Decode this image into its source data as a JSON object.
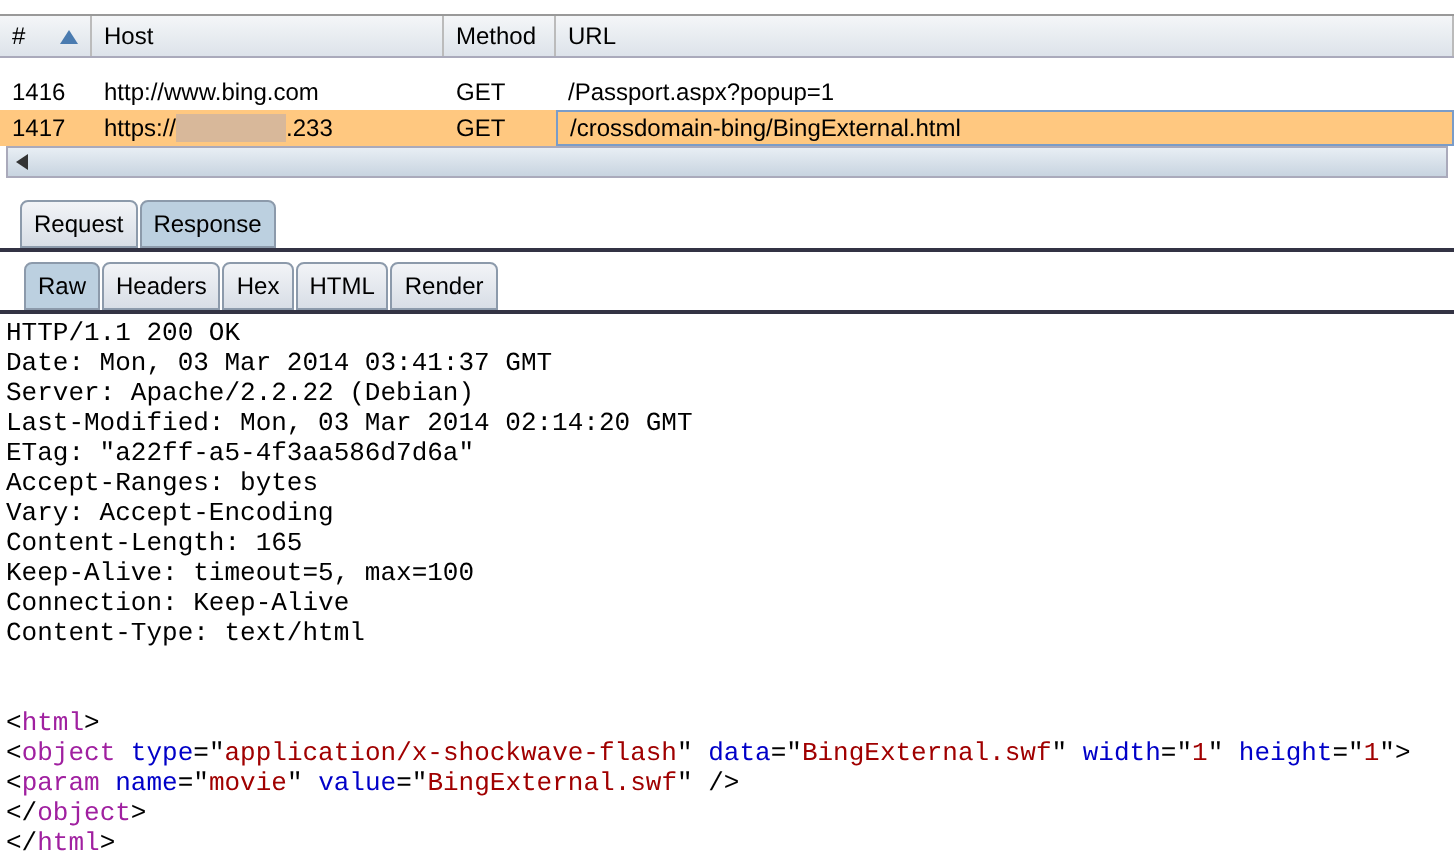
{
  "table": {
    "columns": [
      {
        "label": "#",
        "sorted": true
      },
      {
        "label": "Host",
        "sorted": false
      },
      {
        "label": "Method",
        "sorted": false
      },
      {
        "label": "URL",
        "sorted": false
      }
    ],
    "rows": [
      {
        "number": "1416",
        "host": "http://www.bing.com",
        "method": "GET",
        "url": "/Passport.aspx?popup=1",
        "selected": false
      },
      {
        "number": "1417",
        "host": "https://",
        "host_tail": ".233",
        "method": "GET",
        "url": "/crossdomain-bing/BingExternal.html",
        "selected": true
      }
    ]
  },
  "tabs": [
    {
      "label": "Request",
      "selected": false
    },
    {
      "label": "Response",
      "selected": true
    }
  ],
  "subtabs": [
    {
      "label": "Raw",
      "selected": true
    },
    {
      "label": "Headers",
      "selected": false
    },
    {
      "label": "Hex",
      "selected": false
    },
    {
      "label": "HTML",
      "selected": false
    },
    {
      "label": "Render",
      "selected": false
    }
  ],
  "headers": [
    "HTTP/1.1 200 OK",
    "Date: Mon, 03 Mar 2014 03:41:37 GMT",
    "Server: Apache/2.2.22 (Debian)",
    "Last-Modified: Mon, 03 Mar 2014 02:14:20 GMT",
    "ETag: \"a22ff-a5-4f3aa586d7d6a\"",
    "Accept-Ranges: bytes",
    "Vary: Accept-Encoding",
    "Content-Length: 165",
    "Keep-Alive: timeout=5, max=100",
    "Connection: Keep-Alive",
    "Content-Type: text/html"
  ],
  "html": [
    [
      {
        "kind": "plain",
        "text": "<"
      },
      {
        "kind": "tag",
        "text": "html"
      },
      {
        "kind": "plain",
        "text": ">"
      }
    ],
    [
      {
        "kind": "plain",
        "text": "<"
      },
      {
        "kind": "tag",
        "text": "object"
      },
      {
        "kind": "attr",
        "text": " type"
      },
      {
        "kind": "plain",
        "text": "=\""
      },
      {
        "kind": "value",
        "text": "application/x-shockwave-flash"
      },
      {
        "kind": "plain",
        "text": "\" "
      },
      {
        "kind": "attr",
        "text": "data"
      },
      {
        "kind": "plain",
        "text": "=\""
      },
      {
        "kind": "value",
        "text": "BingExternal.swf"
      },
      {
        "kind": "plain",
        "text": "\" "
      },
      {
        "kind": "attr",
        "text": "width"
      },
      {
        "kind": "plain",
        "text": "=\""
      },
      {
        "kind": "value",
        "text": "1"
      },
      {
        "kind": "plain",
        "text": "\" "
      },
      {
        "kind": "attr",
        "text": "height"
      },
      {
        "kind": "plain",
        "text": "=\""
      },
      {
        "kind": "value",
        "text": "1"
      },
      {
        "kind": "plain",
        "text": "\">"
      }
    ],
    [
      {
        "kind": "plain",
        "text": "<"
      },
      {
        "kind": "tag",
        "text": "param"
      },
      {
        "kind": "attr",
        "text": " name"
      },
      {
        "kind": "plain",
        "text": "=\""
      },
      {
        "kind": "value",
        "text": "movie"
      },
      {
        "kind": "plain",
        "text": "\" "
      },
      {
        "kind": "attr",
        "text": "value"
      },
      {
        "kind": "plain",
        "text": "=\""
      },
      {
        "kind": "value",
        "text": "BingExternal.swf"
      },
      {
        "kind": "plain",
        "text": "\" />"
      }
    ],
    [
      {
        "kind": "plain",
        "text": "</"
      },
      {
        "kind": "tag",
        "text": "object"
      },
      {
        "kind": "plain",
        "text": ">"
      }
    ],
    [
      {
        "kind": "plain",
        "text": "</"
      },
      {
        "kind": "tag",
        "text": "html"
      },
      {
        "kind": "plain",
        "text": ">"
      }
    ]
  ]
}
